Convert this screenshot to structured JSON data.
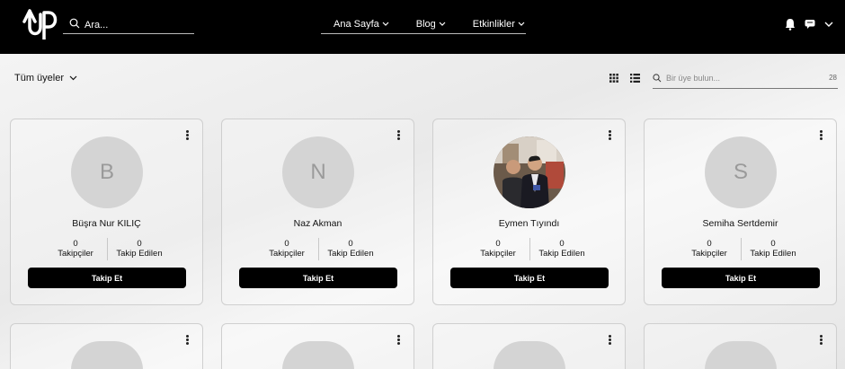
{
  "header": {
    "search_placeholder": "Ara...",
    "nav": [
      "Ana Sayfa",
      "Blog",
      "Etkinlikler"
    ]
  },
  "toolbar": {
    "filter_label": "Tüm üyeler",
    "member_search_placeholder": "Bir üye bulun...",
    "member_count": "28"
  },
  "members": [
    {
      "initial": "B",
      "name": "Büşra Nur KILIÇ",
      "followers": "0",
      "following": "0"
    },
    {
      "initial": "N",
      "name": "Naz Akman",
      "followers": "0",
      "following": "0"
    },
    {
      "initial": "",
      "name": "Eymen Tıyındı",
      "followers": "0",
      "following": "0"
    },
    {
      "initial": "S",
      "name": "Semiha Sertdemir",
      "followers": "0",
      "following": "0"
    }
  ],
  "labels": {
    "followers": "Takipçiler",
    "following": "Takip Edilen",
    "follow_button": "Takip Et"
  }
}
